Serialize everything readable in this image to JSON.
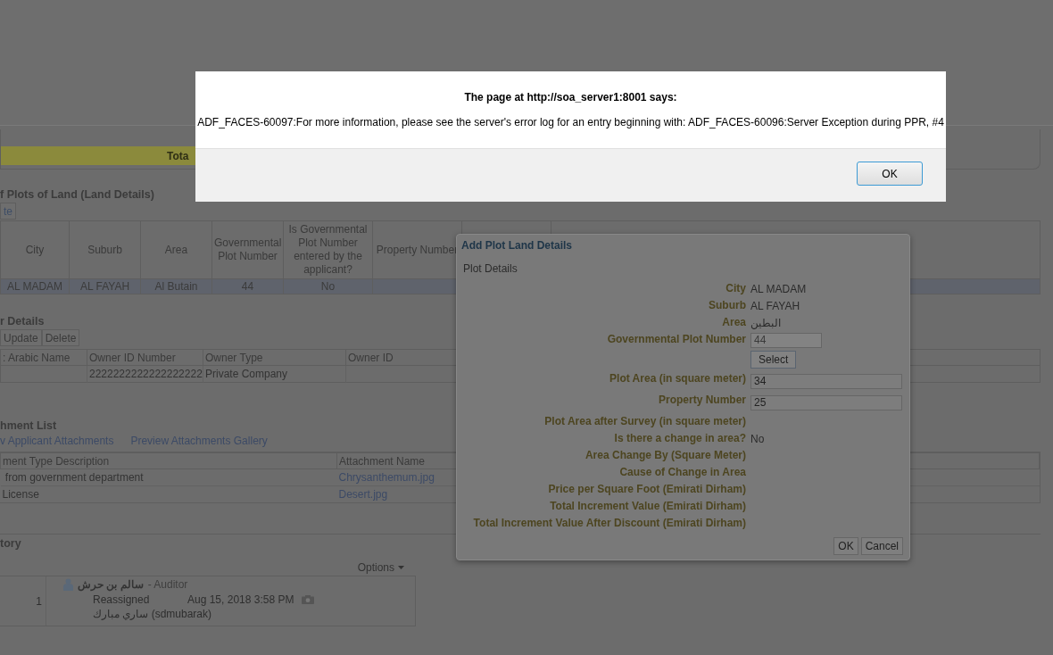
{
  "page": {
    "summary_bar": {
      "label": "Tota"
    },
    "plots": {
      "title": "f Plots of Land (Land Details)",
      "buttons": [
        "te"
      ],
      "table": {
        "columns": [
          "City",
          "Suburb",
          "Area",
          "Governmental Plot Number",
          "Is Governmental Plot Number entered by the applicant?",
          "Property Number"
        ],
        "rows": [
          {
            "cells": [
              "AL MADAM",
              "AL FAYAH",
              "Al Butain",
              "44",
              "No",
              ""
            ],
            "selected": true
          }
        ]
      }
    },
    "owners": {
      "title": "r Details",
      "buttons": [
        {
          "label": "Update",
          "disabled": true
        },
        {
          "label": "Delete",
          "disabled": true
        }
      ],
      "table": {
        "columns": [
          ": Arabic Name",
          "Owner ID Number",
          "Owner Type",
          "Owner ID"
        ],
        "rows": [
          {
            "cells": [
              "",
              "2222222222222222222",
              "Private Company",
              ""
            ]
          }
        ]
      }
    },
    "attachments": {
      "title": "hment List",
      "links": [
        "v Applicant Attachments",
        "Preview Attachments Gallery"
      ],
      "table": {
        "columns": [
          "ment Type Description",
          "Attachment Name"
        ],
        "rows": [
          {
            "cells": [
              " from government department",
              "Chrysanthemum.jpg"
            ]
          },
          {
            "cells": [
              "License",
              "Desert.jpg"
            ]
          }
        ]
      }
    },
    "history": {
      "title": "tory",
      "options": "Options",
      "entries": [
        {
          "index": "1",
          "name": "سالم بن حرش",
          "role": " - Auditor",
          "action": "Reassigned",
          "date": "Aug 15, 2018 3:58 PM",
          "assignee": "ساري مبارك (sdmubarak)"
        }
      ]
    }
  },
  "dialog": {
    "title": "Add Plot Land Details",
    "section": "Plot Details",
    "fields": [
      {
        "kind": "text",
        "label": "City",
        "value": "AL MADAM"
      },
      {
        "kind": "text",
        "label": "Suburb",
        "value": "AL FAYAH"
      },
      {
        "kind": "text",
        "label": "Area",
        "value": "البطين"
      },
      {
        "kind": "input",
        "label": "Governmental Plot Number",
        "value": "44",
        "disabled": true
      },
      {
        "kind": "button",
        "value": "Select"
      },
      {
        "kind": "input",
        "label": "Plot Area (in square meter)",
        "value": "34",
        "disabled": false
      },
      {
        "kind": "input",
        "label": "Property Number",
        "value": "25",
        "disabled": false
      },
      {
        "kind": "text",
        "label": "Plot Area after Survey (in square meter)"
      },
      {
        "kind": "text",
        "label": "Is there a change in area?",
        "value": "No"
      },
      {
        "kind": "text",
        "label": "Area Change By (Square Meter)"
      },
      {
        "kind": "text",
        "label": "Cause of Change in Area"
      },
      {
        "kind": "text",
        "label": "Price per Square Foot (Emirati Dirham)"
      },
      {
        "kind": "text",
        "label": "Total Increment Value (Emirati Dirham)"
      },
      {
        "kind": "text",
        "label": "Total Increment Value After Discount (Emirati Dirham)"
      }
    ],
    "buttons": [
      "OK",
      "Cancel"
    ]
  },
  "alert": {
    "title": "The page at http://soa_server1:8001 says:",
    "message": "ADF_FACES-60097:For more information, please see the server's error log for an entry beginning with: ADF_FACES-60096:Server Exception during PPR, #4",
    "button": "OK"
  }
}
